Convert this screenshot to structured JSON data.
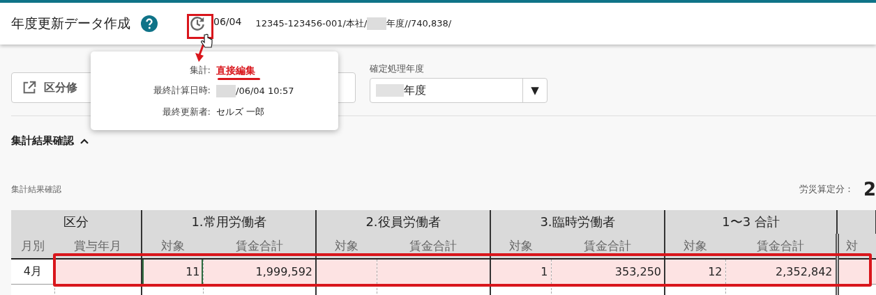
{
  "header": {
    "title": "年度更新データ作成",
    "date_fragment": "06/04",
    "path_before": "12345-123456-001/本社/",
    "path_after": "年度//740,838/"
  },
  "popover": {
    "rows": [
      {
        "label": "集計:",
        "kind": "link",
        "value": "直接編集"
      },
      {
        "label": "最終計算日時:",
        "kind": "redacted",
        "value": "/06/04 10:57"
      },
      {
        "label": "最終更新者:",
        "kind": "text",
        "value": "セルズ 一郎"
      }
    ]
  },
  "toolbar": {
    "button": "区分修",
    "select_label": "確定処理年度",
    "select_value": "年度",
    "select_arrow": "▼"
  },
  "section": {
    "title": "集計結果確認",
    "expanded": true,
    "subtitle": "集計結果確認",
    "summary_label": "労災算定分：",
    "summary_value": "2"
  },
  "table": {
    "groups": [
      "区分",
      "1.常用労働者",
      "2.役員労働者",
      "3.臨時労働者",
      "1〜3 合計"
    ],
    "columns": [
      "月別",
      "賞与年月",
      "対象",
      "賃金合計",
      "対象",
      "賃金合計",
      "対象",
      "賃金合計",
      "対象",
      "賃金合計",
      "対"
    ],
    "rows": [
      {
        "highlighted": true,
        "cells": [
          {
            "text": "4月",
            "focused": false
          },
          {
            "text": "",
            "focused": false
          },
          {
            "text": "11",
            "focused": true
          },
          {
            "text": "1,999,592",
            "focused": false
          },
          {
            "text": "",
            "focused": false
          },
          {
            "text": "",
            "focused": false
          },
          {
            "text": "1",
            "focused": false
          },
          {
            "text": "353,250",
            "focused": false
          },
          {
            "text": "12",
            "focused": false
          },
          {
            "text": "2,352,842",
            "focused": false
          },
          {
            "text": "",
            "focused": false
          }
        ]
      }
    ]
  }
}
